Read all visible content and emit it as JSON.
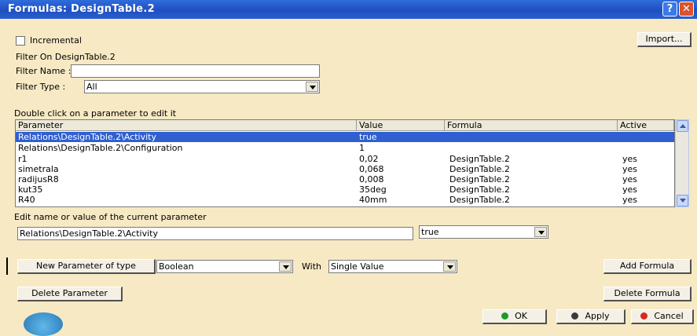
{
  "window": {
    "title": "Formulas: DesignTable.2"
  },
  "incremental_label": "Incremental",
  "import_label": "Import...",
  "filter": {
    "on_label": "Filter On DesignTable.2",
    "name_label": "Filter Name :",
    "name_value": "",
    "type_label": "Filter Type :",
    "type_value": "All"
  },
  "table_hint": "Double click on a parameter to edit it",
  "table": {
    "columns": [
      "Parameter",
      "Value",
      "Formula",
      "Active"
    ],
    "rows": [
      {
        "parameter": "Relations\\DesignTable.2\\Activity",
        "value": "true",
        "formula": "",
        "active": ""
      },
      {
        "parameter": "Relations\\DesignTable.2\\Configuration",
        "value": "1",
        "formula": "",
        "active": ""
      },
      {
        "parameter": "r1",
        "value": "0,02",
        "formula": "DesignTable.2",
        "active": "yes"
      },
      {
        "parameter": "simetrala",
        "value": "0,068",
        "formula": "DesignTable.2",
        "active": "yes"
      },
      {
        "parameter": "radijusR8",
        "value": "0,008",
        "formula": "DesignTable.2",
        "active": "yes"
      },
      {
        "parameter": "kut35",
        "value": "35deg",
        "formula": "DesignTable.2",
        "active": "yes"
      },
      {
        "parameter": "R40",
        "value": "40mm",
        "formula": "DesignTable.2",
        "active": "yes"
      }
    ]
  },
  "edit": {
    "label": "Edit name or value of the current parameter",
    "name_value": "Relations\\DesignTable.2\\Activity",
    "value_value": "true"
  },
  "new_param": {
    "button_label": "New Parameter of type",
    "type_value": "Boolean",
    "with_label": "With",
    "with_value": "Single Value"
  },
  "buttons": {
    "add_formula": "Add Formula",
    "delete_parameter": "Delete Parameter",
    "delete_formula": "Delete Formula",
    "ok": "OK",
    "apply": "Apply",
    "cancel": "Cancel"
  },
  "colors": {
    "title_bar": "#2f6cdc",
    "selection": "#2f5fd0",
    "dialog_bg": "#f6e9c4"
  }
}
